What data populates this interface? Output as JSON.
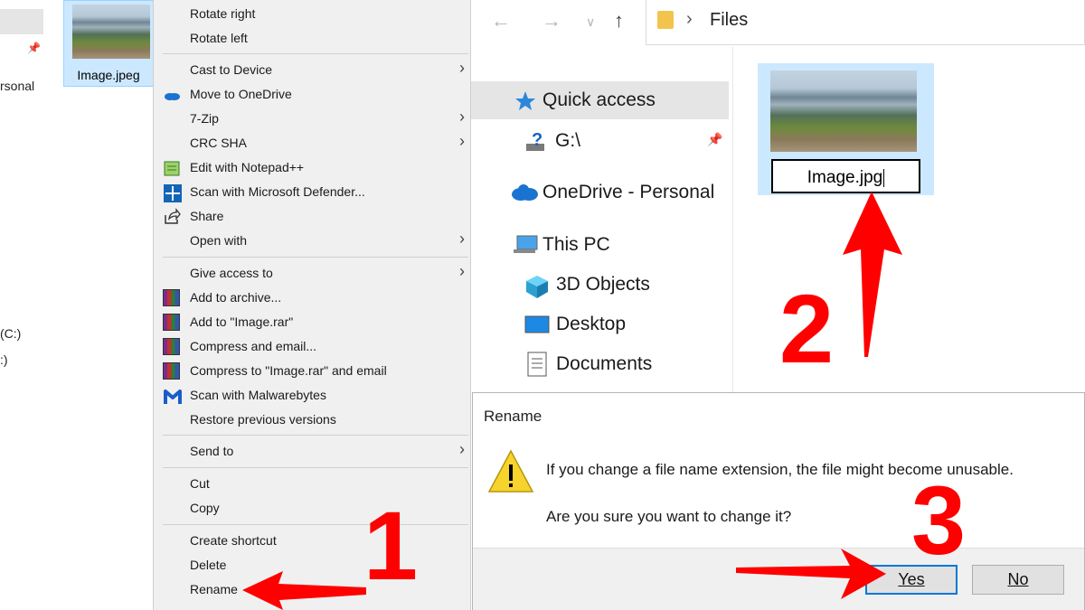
{
  "left_strip": {
    "labels": [
      "rsonal",
      "(C:)",
      ":)"
    ]
  },
  "file_tile": {
    "name": "Image.jpeg"
  },
  "context_menu": {
    "items": [
      {
        "label": "Rotate right",
        "icon": "",
        "submenu": false
      },
      {
        "label": "Rotate left",
        "icon": "",
        "submenu": false
      },
      {
        "label": "Cast to Device",
        "icon": "",
        "submenu": true
      },
      {
        "label": "Move to OneDrive",
        "icon": "onedrive-icon",
        "submenu": false
      },
      {
        "label": "7-Zip",
        "icon": "",
        "submenu": true
      },
      {
        "label": "CRC SHA",
        "icon": "",
        "submenu": true
      },
      {
        "label": "Edit with Notepad++",
        "icon": "notepadpp-icon",
        "submenu": false
      },
      {
        "label": "Scan with Microsoft Defender...",
        "icon": "defender-icon",
        "submenu": false
      },
      {
        "label": "Share",
        "icon": "share-icon",
        "submenu": false
      },
      {
        "label": "Open with",
        "icon": "",
        "submenu": true
      },
      {
        "label": "Give access to",
        "icon": "",
        "submenu": true
      },
      {
        "label": "Add to archive...",
        "icon": "winrar-icon",
        "submenu": false
      },
      {
        "label": "Add to \"Image.rar\"",
        "icon": "winrar-icon",
        "submenu": false
      },
      {
        "label": "Compress and email...",
        "icon": "winrar-icon",
        "submenu": false
      },
      {
        "label": "Compress to \"Image.rar\" and email",
        "icon": "winrar-icon",
        "submenu": false
      },
      {
        "label": "Scan with Malwarebytes",
        "icon": "malwarebytes-icon",
        "submenu": false
      },
      {
        "label": "Restore previous versions",
        "icon": "",
        "submenu": false
      },
      {
        "label": "Send to",
        "icon": "",
        "submenu": true
      },
      {
        "label": "Cut",
        "icon": "",
        "submenu": false
      },
      {
        "label": "Copy",
        "icon": "",
        "submenu": false
      },
      {
        "label": "Create shortcut",
        "icon": "",
        "submenu": false
      },
      {
        "label": "Delete",
        "icon": "",
        "submenu": false
      },
      {
        "label": "Rename",
        "icon": "",
        "submenu": false
      }
    ]
  },
  "address_bar": {
    "path": "Files"
  },
  "nav_pane": {
    "quick_access": "Quick access",
    "g_drive": "G:\\",
    "onedrive": "OneDrive - Personal",
    "this_pc": "This PC",
    "objects_3d": "3D Objects",
    "desktop": "Desktop",
    "documents": "Documents"
  },
  "content": {
    "rename_value": "Image.jpg"
  },
  "dialog": {
    "title": "Rename",
    "message": "If you change a file name extension, the file might become unusable.",
    "question": "Are you sure you want to change it?",
    "yes_label": "Yes",
    "no_label": "No"
  },
  "annotations": {
    "step1": "1",
    "step2": "2",
    "step3": "3",
    "color": "#ff0000"
  }
}
